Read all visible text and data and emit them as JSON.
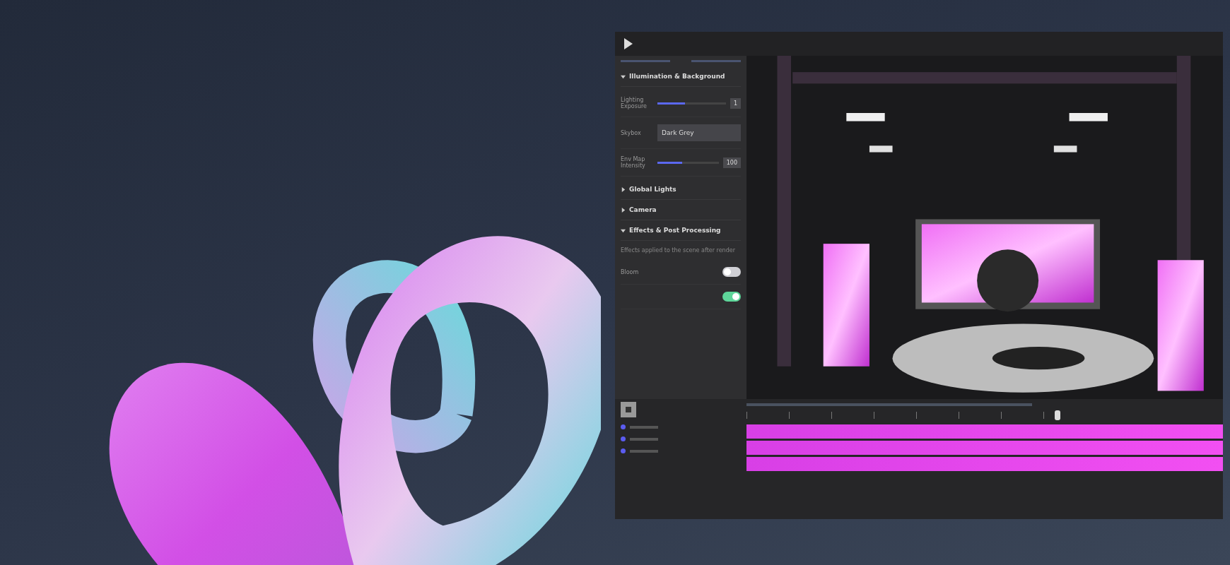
{
  "panel": {
    "sections": [
      {
        "title": "Illumination & Background",
        "expanded": true,
        "controls": [
          {
            "kind": "slider",
            "label": "Lighting Exposure",
            "level": 0.4,
            "reading": "1"
          },
          {
            "kind": "dropdown",
            "label": "Skybox",
            "value": "Dark Grey"
          },
          {
            "kind": "slider",
            "label": "Env Map Intensity",
            "level": 0.4,
            "reading": "100"
          }
        ]
      },
      {
        "title": "Global Lights",
        "expanded": false
      },
      {
        "title": "Camera",
        "expanded": false
      },
      {
        "title": "Effects & Post Processing",
        "expanded": true,
        "description": "Effects applied to the scene after render",
        "controls": [
          {
            "kind": "toggle",
            "label": "Bloom",
            "on": false
          },
          {
            "kind": "toggle",
            "on": true
          }
        ]
      }
    ]
  },
  "timeline": {
    "tracks": [
      {
        "color": "#5b5cf0"
      },
      {
        "color": "#5b5cf0"
      },
      {
        "color": "#5b5cf0"
      }
    ]
  }
}
